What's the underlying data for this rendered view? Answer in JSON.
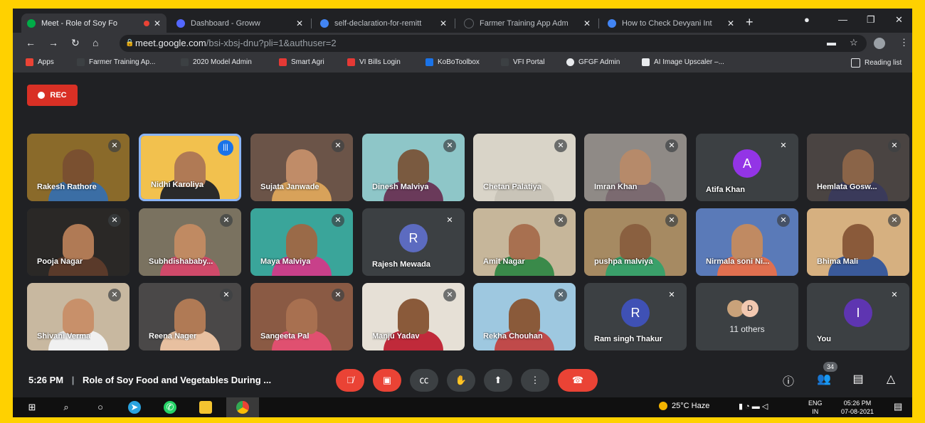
{
  "browser": {
    "tabs": [
      {
        "title": "Meet - Role of Soy Fo",
        "active": true,
        "recording": true
      },
      {
        "title": "Dashboard - Groww"
      },
      {
        "title": "self-declaration-for-remitt"
      },
      {
        "title": "Farmer Training App Adm"
      },
      {
        "title": "How to Check Devyani Int"
      }
    ],
    "url_host": "meet.google.com",
    "url_path": "/bsi-xbsj-dnu?pli=1&authuser=2",
    "bookmarks": [
      "Apps",
      "Farmer Training Ap...",
      "2020 Model Admin",
      "Smart Agri",
      "VI Bills Login",
      "KoBoToolbox",
      "VFI Portal",
      "GFGF Admin",
      "AI Image Upscaler –...",
      "Reading list"
    ]
  },
  "meet": {
    "rec_label": "REC",
    "participants": [
      {
        "name": "Rakesh Rathore",
        "type": "video",
        "scene": "#8a6a2a",
        "skin": "#7a5030",
        "shirt": "#3b6ea5"
      },
      {
        "name": "Nidhi Karoliya",
        "type": "video",
        "speaking": true,
        "scene": "#f2c14e",
        "skin": "#b07a55",
        "shirt": "#2a2a2a"
      },
      {
        "name": "Sujata Janwade",
        "type": "video",
        "scene": "#6b5448",
        "skin": "#c08c68",
        "shirt": "#d8a25a"
      },
      {
        "name": "Dinesh Malviya",
        "type": "video",
        "scene": "#8ec6c8",
        "skin": "#7a5a40",
        "shirt": "#6a3a5a"
      },
      {
        "name": "Chetan Palatiya",
        "type": "video",
        "scene": "#d9d4c8",
        "skin": "#d9d4c8",
        "shirt": "#c9c4b8"
      },
      {
        "name": "Imran Khan",
        "type": "video",
        "scene": "#8f8a86",
        "skin": "#b68a6a",
        "shirt": "#7b6a70"
      },
      {
        "name": "Atifa Khan",
        "type": "avatar",
        "initial": "A",
        "color": "#9334e6"
      },
      {
        "name": "Hemlata Gosw...",
        "type": "video",
        "scene": "#4a4442",
        "skin": "#8a6448",
        "shirt": "#3a3a5a"
      },
      {
        "name": "Pooja Nagar",
        "type": "video",
        "scene": "#2a2826",
        "skin": "#b07a55",
        "shirt": "#5a3a2a"
      },
      {
        "name": "Subhdishababy...",
        "type": "video",
        "scene": "#7a7260",
        "skin": "#c08a62",
        "shirt": "#d04a6a"
      },
      {
        "name": "Maya Malviya",
        "type": "video",
        "scene": "#3aa59a",
        "skin": "#9a6a48",
        "shirt": "#c8408a"
      },
      {
        "name": "Rajesh Mewada",
        "type": "avatar",
        "initial": "R",
        "color": "#5c6bc0"
      },
      {
        "name": "Amit Nagar",
        "type": "video",
        "scene": "#c6b69a",
        "skin": "#a87050",
        "shirt": "#3a8a4a"
      },
      {
        "name": "pushpa malviya",
        "type": "video",
        "scene": "#a68a62",
        "skin": "#8a6040",
        "shirt": "#3aa06a"
      },
      {
        "name": "Nirmala soni Ni...",
        "type": "video",
        "scene": "#5a7ab8",
        "skin": "#c08a62",
        "shirt": "#e07050"
      },
      {
        "name": "Bhima Mali",
        "type": "video",
        "scene": "#d6b080",
        "skin": "#8a5a3a",
        "shirt": "#3a5a9a"
      },
      {
        "name": "Shivani Verma",
        "type": "video",
        "scene": "#c8b8a0",
        "skin": "#c8906a",
        "shirt": "#f0f0f0"
      },
      {
        "name": "Reena Nager",
        "type": "video",
        "scene": "#4a4848",
        "skin": "#b07a55",
        "shirt": "#e8c0a0"
      },
      {
        "name": "Sangeeta Pal",
        "type": "video",
        "scene": "#8a5a44",
        "skin": "#a87050",
        "shirt": "#e05070"
      },
      {
        "name": "Manju Yadav",
        "type": "video",
        "scene": "#e6e0d6",
        "skin": "#8a5a3a",
        "shirt": "#c02a3a"
      },
      {
        "name": "Rekha Chouhan",
        "type": "video",
        "scene": "#9ec8e0",
        "skin": "#8a5a3a",
        "shirt": "#c04a4a"
      },
      {
        "name": "Ram singh Thakur",
        "type": "avatar",
        "initial": "R",
        "color": "#3f51b5"
      },
      {
        "name": "11 others",
        "type": "others",
        "initials": [
          "",
          "D"
        ]
      },
      {
        "name": "You",
        "type": "avatar",
        "initial": "I",
        "color": "#5e35b1"
      }
    ],
    "time": "5:26 PM",
    "separator": "|",
    "meeting_title": "Role of Soy Food and Vegetables During ...",
    "people_count": "34"
  },
  "taskbar": {
    "weather": "25°C Haze",
    "lang_1": "ENG",
    "lang_2": "IN",
    "time": "05:26 PM",
    "date": "07-08-2021"
  },
  "icons": [
    "windows-icon",
    "search-icon",
    "cortana-icon",
    "telegram-icon",
    "whatsapp-icon",
    "file-explorer-icon",
    "chrome-icon"
  ]
}
